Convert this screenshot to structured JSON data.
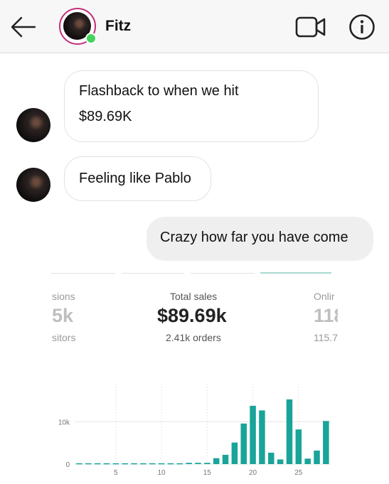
{
  "header": {
    "contact_name": "Fitz",
    "icons": {
      "back": "back-arrow-icon",
      "video": "video-camera-icon",
      "info": "info-icon"
    },
    "online_color": "#44d35c",
    "story_ring_color": "#c2307a"
  },
  "messages": [
    {
      "from": "Fitz",
      "lines": [
        "Flashback to when we hit",
        "$89.69K"
      ]
    },
    {
      "from": "Fitz",
      "lines": [
        "Feeling like Pablo"
      ]
    },
    {
      "from": "me",
      "lines": [
        "Crazy how far you have come"
      ]
    }
  ],
  "analytics": {
    "left_stat": {
      "label": "sions",
      "value": "5k",
      "sub": "sitors"
    },
    "center_stat": {
      "label": "Total sales",
      "value": "$89.69k",
      "sub": "2.41k orders"
    },
    "right_stat": {
      "label": "Onlir",
      "value": "118",
      "sub": "115.7"
    }
  },
  "chart_data": {
    "type": "bar",
    "color": "#19a49a",
    "x": [
      1,
      2,
      3,
      4,
      5,
      6,
      7,
      8,
      9,
      10,
      11,
      12,
      13,
      14,
      15,
      16,
      17,
      18,
      19,
      20,
      21,
      22,
      23,
      24,
      25,
      26,
      27,
      28
    ],
    "values": [
      200,
      200,
      200,
      200,
      200,
      200,
      200,
      200,
      200,
      200,
      200,
      200,
      300,
      300,
      300,
      1400,
      2200,
      5100,
      9600,
      13800,
      12700,
      2700,
      1100,
      15300,
      8200,
      1300,
      3200,
      10200
    ],
    "x_ticks": [
      5,
      10,
      15,
      20,
      25
    ],
    "y_ticks": [
      0,
      10000
    ],
    "y_tick_labels": [
      "0",
      "10k"
    ],
    "ylim": [
      0,
      19000
    ],
    "title": "",
    "xlabel": "",
    "ylabel": ""
  }
}
